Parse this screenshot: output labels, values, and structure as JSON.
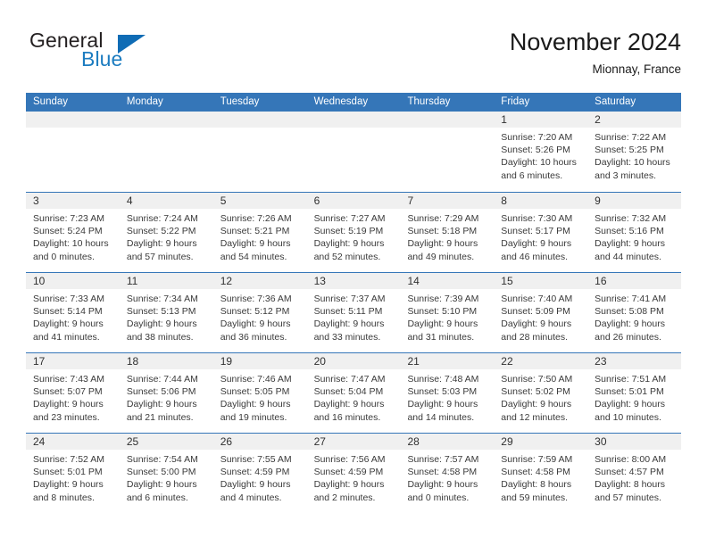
{
  "brand": {
    "name_part1": "General",
    "name_part2": "Blue",
    "triangle_color": "#0f6cb5"
  },
  "header": {
    "title": "November 2024",
    "location": "Mionnay, France"
  },
  "colors": {
    "header_band": "#3576b8",
    "day_band": "#f0f0f0",
    "brand_blue": "#1c7cc0",
    "row_separator": "#3576b8"
  },
  "weekdays": [
    "Sunday",
    "Monday",
    "Tuesday",
    "Wednesday",
    "Thursday",
    "Friday",
    "Saturday"
  ],
  "weeks": [
    [
      {
        "day": "",
        "empty": true
      },
      {
        "day": "",
        "empty": true
      },
      {
        "day": "",
        "empty": true
      },
      {
        "day": "",
        "empty": true
      },
      {
        "day": "",
        "empty": true
      },
      {
        "day": "1",
        "sunrise": "Sunrise: 7:20 AM",
        "sunset": "Sunset: 5:26 PM",
        "daylight1": "Daylight: 10 hours",
        "daylight2": "and 6 minutes."
      },
      {
        "day": "2",
        "sunrise": "Sunrise: 7:22 AM",
        "sunset": "Sunset: 5:25 PM",
        "daylight1": "Daylight: 10 hours",
        "daylight2": "and 3 minutes."
      }
    ],
    [
      {
        "day": "3",
        "sunrise": "Sunrise: 7:23 AM",
        "sunset": "Sunset: 5:24 PM",
        "daylight1": "Daylight: 10 hours",
        "daylight2": "and 0 minutes."
      },
      {
        "day": "4",
        "sunrise": "Sunrise: 7:24 AM",
        "sunset": "Sunset: 5:22 PM",
        "daylight1": "Daylight: 9 hours",
        "daylight2": "and 57 minutes."
      },
      {
        "day": "5",
        "sunrise": "Sunrise: 7:26 AM",
        "sunset": "Sunset: 5:21 PM",
        "daylight1": "Daylight: 9 hours",
        "daylight2": "and 54 minutes."
      },
      {
        "day": "6",
        "sunrise": "Sunrise: 7:27 AM",
        "sunset": "Sunset: 5:19 PM",
        "daylight1": "Daylight: 9 hours",
        "daylight2": "and 52 minutes."
      },
      {
        "day": "7",
        "sunrise": "Sunrise: 7:29 AM",
        "sunset": "Sunset: 5:18 PM",
        "daylight1": "Daylight: 9 hours",
        "daylight2": "and 49 minutes."
      },
      {
        "day": "8",
        "sunrise": "Sunrise: 7:30 AM",
        "sunset": "Sunset: 5:17 PM",
        "daylight1": "Daylight: 9 hours",
        "daylight2": "and 46 minutes."
      },
      {
        "day": "9",
        "sunrise": "Sunrise: 7:32 AM",
        "sunset": "Sunset: 5:16 PM",
        "daylight1": "Daylight: 9 hours",
        "daylight2": "and 44 minutes."
      }
    ],
    [
      {
        "day": "10",
        "sunrise": "Sunrise: 7:33 AM",
        "sunset": "Sunset: 5:14 PM",
        "daylight1": "Daylight: 9 hours",
        "daylight2": "and 41 minutes."
      },
      {
        "day": "11",
        "sunrise": "Sunrise: 7:34 AM",
        "sunset": "Sunset: 5:13 PM",
        "daylight1": "Daylight: 9 hours",
        "daylight2": "and 38 minutes."
      },
      {
        "day": "12",
        "sunrise": "Sunrise: 7:36 AM",
        "sunset": "Sunset: 5:12 PM",
        "daylight1": "Daylight: 9 hours",
        "daylight2": "and 36 minutes."
      },
      {
        "day": "13",
        "sunrise": "Sunrise: 7:37 AM",
        "sunset": "Sunset: 5:11 PM",
        "daylight1": "Daylight: 9 hours",
        "daylight2": "and 33 minutes."
      },
      {
        "day": "14",
        "sunrise": "Sunrise: 7:39 AM",
        "sunset": "Sunset: 5:10 PM",
        "daylight1": "Daylight: 9 hours",
        "daylight2": "and 31 minutes."
      },
      {
        "day": "15",
        "sunrise": "Sunrise: 7:40 AM",
        "sunset": "Sunset: 5:09 PM",
        "daylight1": "Daylight: 9 hours",
        "daylight2": "and 28 minutes."
      },
      {
        "day": "16",
        "sunrise": "Sunrise: 7:41 AM",
        "sunset": "Sunset: 5:08 PM",
        "daylight1": "Daylight: 9 hours",
        "daylight2": "and 26 minutes."
      }
    ],
    [
      {
        "day": "17",
        "sunrise": "Sunrise: 7:43 AM",
        "sunset": "Sunset: 5:07 PM",
        "daylight1": "Daylight: 9 hours",
        "daylight2": "and 23 minutes."
      },
      {
        "day": "18",
        "sunrise": "Sunrise: 7:44 AM",
        "sunset": "Sunset: 5:06 PM",
        "daylight1": "Daylight: 9 hours",
        "daylight2": "and 21 minutes."
      },
      {
        "day": "19",
        "sunrise": "Sunrise: 7:46 AM",
        "sunset": "Sunset: 5:05 PM",
        "daylight1": "Daylight: 9 hours",
        "daylight2": "and 19 minutes."
      },
      {
        "day": "20",
        "sunrise": "Sunrise: 7:47 AM",
        "sunset": "Sunset: 5:04 PM",
        "daylight1": "Daylight: 9 hours",
        "daylight2": "and 16 minutes."
      },
      {
        "day": "21",
        "sunrise": "Sunrise: 7:48 AM",
        "sunset": "Sunset: 5:03 PM",
        "daylight1": "Daylight: 9 hours",
        "daylight2": "and 14 minutes."
      },
      {
        "day": "22",
        "sunrise": "Sunrise: 7:50 AM",
        "sunset": "Sunset: 5:02 PM",
        "daylight1": "Daylight: 9 hours",
        "daylight2": "and 12 minutes."
      },
      {
        "day": "23",
        "sunrise": "Sunrise: 7:51 AM",
        "sunset": "Sunset: 5:01 PM",
        "daylight1": "Daylight: 9 hours",
        "daylight2": "and 10 minutes."
      }
    ],
    [
      {
        "day": "24",
        "sunrise": "Sunrise: 7:52 AM",
        "sunset": "Sunset: 5:01 PM",
        "daylight1": "Daylight: 9 hours",
        "daylight2": "and 8 minutes."
      },
      {
        "day": "25",
        "sunrise": "Sunrise: 7:54 AM",
        "sunset": "Sunset: 5:00 PM",
        "daylight1": "Daylight: 9 hours",
        "daylight2": "and 6 minutes."
      },
      {
        "day": "26",
        "sunrise": "Sunrise: 7:55 AM",
        "sunset": "Sunset: 4:59 PM",
        "daylight1": "Daylight: 9 hours",
        "daylight2": "and 4 minutes."
      },
      {
        "day": "27",
        "sunrise": "Sunrise: 7:56 AM",
        "sunset": "Sunset: 4:59 PM",
        "daylight1": "Daylight: 9 hours",
        "daylight2": "and 2 minutes."
      },
      {
        "day": "28",
        "sunrise": "Sunrise: 7:57 AM",
        "sunset": "Sunset: 4:58 PM",
        "daylight1": "Daylight: 9 hours",
        "daylight2": "and 0 minutes."
      },
      {
        "day": "29",
        "sunrise": "Sunrise: 7:59 AM",
        "sunset": "Sunset: 4:58 PM",
        "daylight1": "Daylight: 8 hours",
        "daylight2": "and 59 minutes."
      },
      {
        "day": "30",
        "sunrise": "Sunrise: 8:00 AM",
        "sunset": "Sunset: 4:57 PM",
        "daylight1": "Daylight: 8 hours",
        "daylight2": "and 57 minutes."
      }
    ]
  ]
}
